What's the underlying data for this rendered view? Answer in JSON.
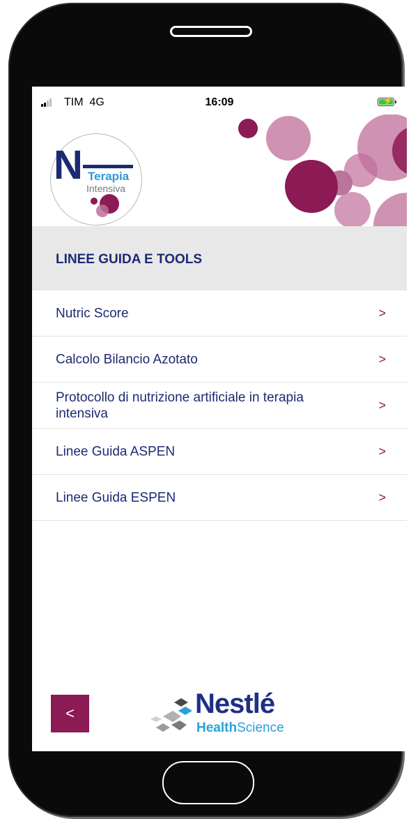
{
  "status_bar": {
    "carrier": "TIM",
    "network": "4G",
    "time": "16:09"
  },
  "logo": {
    "letter": "N",
    "line1": "Terapia",
    "line2": "Intensiva"
  },
  "section": {
    "title": "LINEE GUIDA E TOOLS"
  },
  "menu": [
    {
      "label": "Nutric Score",
      "chevron": ">"
    },
    {
      "label": "Calcolo Bilancio Azotato",
      "chevron": ">"
    },
    {
      "label": "Protocollo di nutrizione artificiale in terapia intensiva",
      "chevron": ">"
    },
    {
      "label": "Linee Guida ASPEN",
      "chevron": ">"
    },
    {
      "label": "Linee Guida ESPEN",
      "chevron": ">"
    }
  ],
  "footer": {
    "back_label": "<",
    "brand_name": "Nestlé",
    "brand_sub_1": "Health",
    "brand_sub_2": "Science"
  },
  "colors": {
    "accent": "#8c1a55",
    "navy": "#1c2a72",
    "section_bg": "#e8e8e8",
    "brand_blue": "#29a1d9"
  }
}
